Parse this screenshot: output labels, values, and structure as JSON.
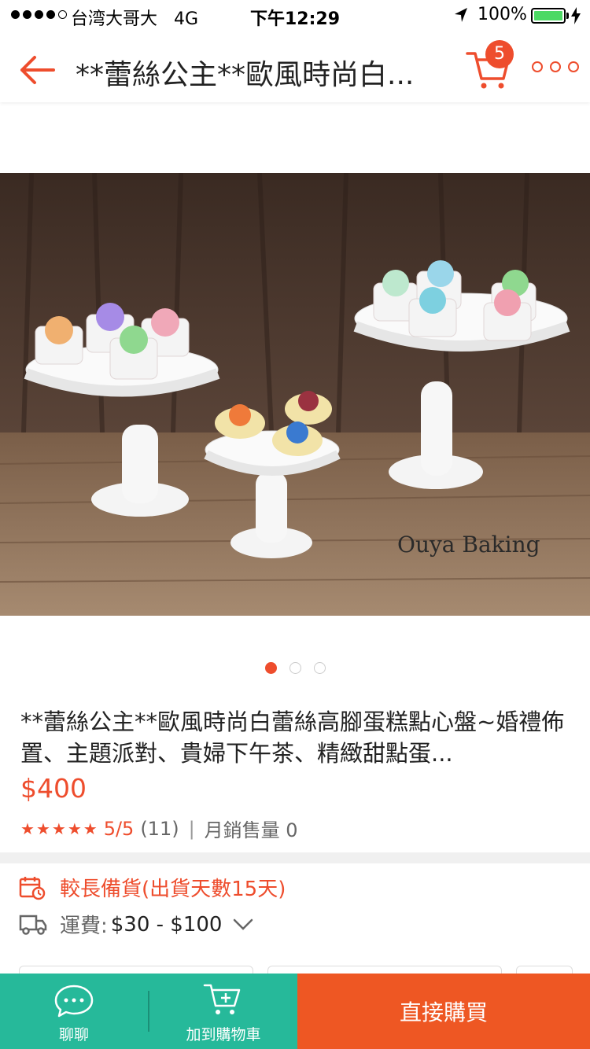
{
  "status_bar": {
    "carrier": "台湾大哥大",
    "network": "4G",
    "time": "下午12:29",
    "battery": "100%"
  },
  "nav": {
    "title": "**蕾絲公主**歐風時尚白...",
    "cart_count": "5"
  },
  "gallery": {
    "watermark": "Ouya Baking",
    "dots": 3,
    "active_dot": 1
  },
  "product": {
    "title": "**蕾絲公主**歐風時尚白蕾絲高腳蛋糕點心盤~婚禮佈置、主題派對、貴婦下午茶、精緻甜點蛋...",
    "price": "$400",
    "rating_score": "5/5",
    "rating_count": "(11)",
    "monthly_sales": "月銷售量 0"
  },
  "shipping": {
    "prep_notice": "較長備貨(出貨天數15天)",
    "fee_label": "運費:",
    "fee_value": "$30 - $100"
  },
  "bottom_bar": {
    "chat_label": "聊聊",
    "add_to_cart_label": "加到購物車",
    "buy_now_label": "直接購買"
  },
  "colors": {
    "accent": "#ee4d2d",
    "teal": "#26b99a",
    "buy": "#ee5723"
  }
}
